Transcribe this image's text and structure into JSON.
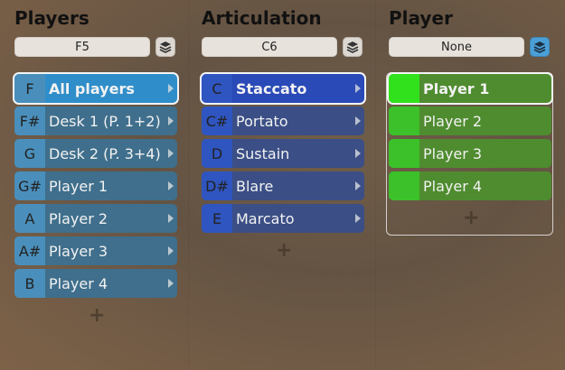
{
  "players": {
    "title": "Players",
    "note": "F5",
    "add": "+",
    "items": [
      {
        "key": "F",
        "label": "All players"
      },
      {
        "key": "F#",
        "label": "Desk 1 (P. 1+2)"
      },
      {
        "key": "G",
        "label": "Desk 2 (P. 3+4)"
      },
      {
        "key": "G#",
        "label": "Player 1"
      },
      {
        "key": "A",
        "label": "Player 2"
      },
      {
        "key": "A#",
        "label": "Player 3"
      },
      {
        "key": "B",
        "label": "Player 4"
      }
    ]
  },
  "articulation": {
    "title": "Articulation",
    "note": "C6",
    "add": "+",
    "items": [
      {
        "key": "C",
        "label": "Staccato"
      },
      {
        "key": "C#",
        "label": "Portato"
      },
      {
        "key": "D",
        "label": "Sustain"
      },
      {
        "key": "D#",
        "label": "Blare"
      },
      {
        "key": "E",
        "label": "Marcato"
      }
    ]
  },
  "player": {
    "title": "Player",
    "note": "None",
    "add": "+",
    "items": [
      {
        "label": "Player 1"
      },
      {
        "label": "Player 2"
      },
      {
        "label": "Player 3"
      },
      {
        "label": "Player 4"
      }
    ]
  },
  "icons": {
    "layers": "layers-icon",
    "chevron": "chevron-right-icon",
    "add": "plus-icon"
  },
  "colors": {
    "players_row": "#3f6f8c",
    "players_key": "#4a8fbb",
    "players_selected": "#2f8ec9",
    "articulation_row": "#3b4f86",
    "articulation_key": "#2f55c0",
    "articulation_selected": "#2a4ab8",
    "player_row": "#4f8c2f",
    "player_key": "#3cc12a",
    "player_selected_key": "#31e11c"
  }
}
